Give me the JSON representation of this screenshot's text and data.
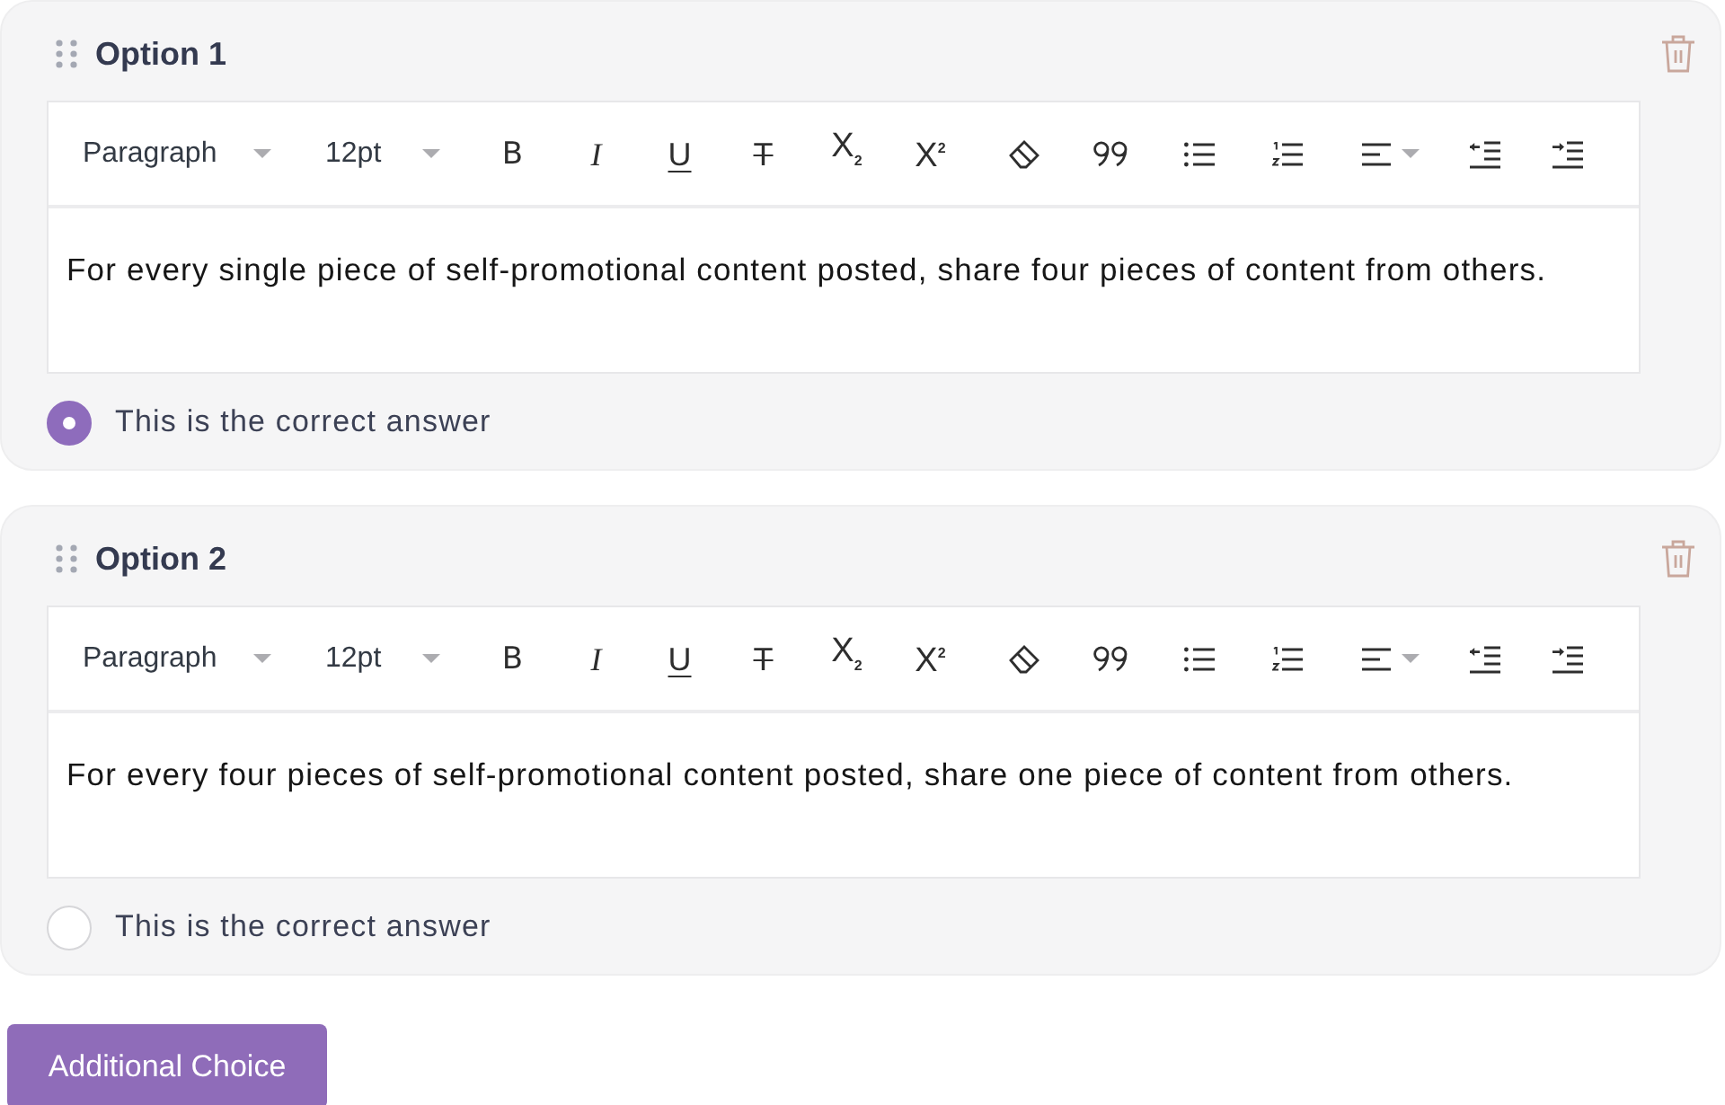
{
  "options": [
    {
      "title": "Option 1",
      "toolbar": {
        "block_format": "Paragraph",
        "font_size": "12pt",
        "format_buttons": [
          {
            "kind": "bold",
            "label": "B"
          },
          {
            "kind": "italic",
            "label": "I"
          },
          {
            "kind": "underline",
            "label": "U"
          },
          {
            "kind": "strike",
            "label": "T"
          },
          {
            "kind": "subscript",
            "label": "X$_{2}$"
          },
          {
            "kind": "superscript",
            "label": "X$^{2}$"
          }
        ]
      },
      "content": "For every single piece of self-promotional content posted, share four pieces of content from others.",
      "correct_label": "This is the correct answer",
      "selected": true
    },
    {
      "title": "Option 2",
      "toolbar": {
        "block_format": "Paragraph",
        "font_size": "12pt",
        "format_buttons": [
          {
            "kind": "bold",
            "label": "B"
          },
          {
            "kind": "italic",
            "label": "I"
          },
          {
            "kind": "underline",
            "label": "U"
          },
          {
            "kind": "strike",
            "label": "T"
          },
          {
            "kind": "subscript",
            "label": "X$_{2}$"
          },
          {
            "kind": "superscript",
            "label": "X$^{2}$"
          }
        ]
      },
      "content": "For every four pieces of self-promotional content posted, share one piece of content from others.",
      "correct_label": "This is the correct answer",
      "selected": false
    }
  ],
  "add_choice_button": {
    "label": "Additional Choice"
  }
}
